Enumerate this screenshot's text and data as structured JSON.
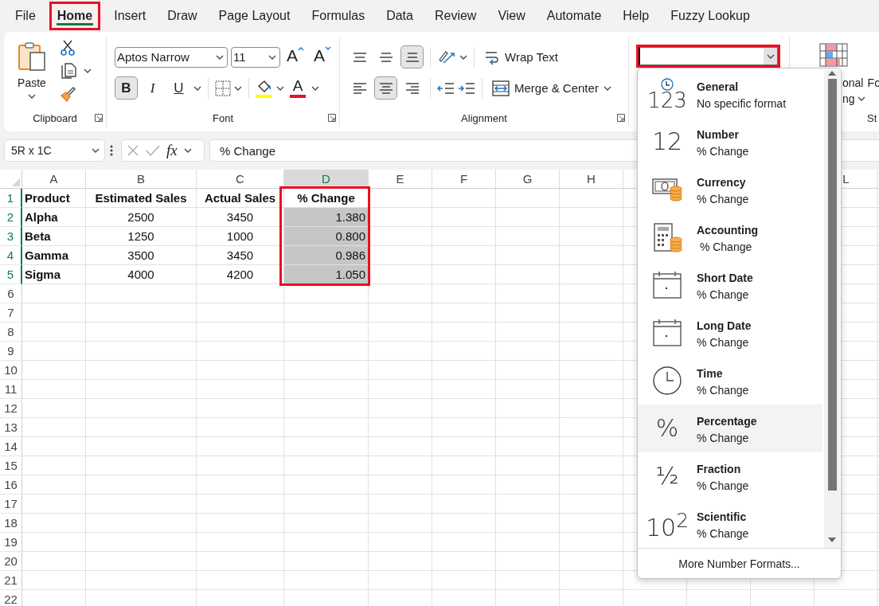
{
  "menu_tabs": [
    {
      "label": "File",
      "selected": false,
      "highlighted": false
    },
    {
      "label": "Home",
      "selected": true,
      "highlighted": true
    },
    {
      "label": "Insert",
      "selected": false,
      "highlighted": false
    },
    {
      "label": "Draw",
      "selected": false,
      "highlighted": false
    },
    {
      "label": "Page Layout",
      "selected": false,
      "highlighted": false
    },
    {
      "label": "Formulas",
      "selected": false,
      "highlighted": false
    },
    {
      "label": "Data",
      "selected": false,
      "highlighted": false
    },
    {
      "label": "Review",
      "selected": false,
      "highlighted": false
    },
    {
      "label": "View",
      "selected": false,
      "highlighted": false
    },
    {
      "label": "Automate",
      "selected": false,
      "highlighted": false
    },
    {
      "label": "Help",
      "selected": false,
      "highlighted": false
    },
    {
      "label": "Fuzzy Lookup",
      "selected": false,
      "highlighted": false
    }
  ],
  "ribbon": {
    "clipboard": {
      "paste_label": "Paste",
      "group_label": "Clipboard"
    },
    "font": {
      "font_name": "Aptos Narrow",
      "font_size": "11",
      "grow_glyph": "A",
      "shrink_glyph": "A",
      "font_color_glyph": "A",
      "group_label": "Font",
      "buttons": [
        {
          "kind": "bold",
          "label": "B",
          "selected": true
        },
        {
          "kind": "italic",
          "label": "I",
          "selected": false
        },
        {
          "kind": "underline",
          "label": "U",
          "selected": false
        }
      ]
    },
    "alignment": {
      "group_label": "Alignment",
      "wrap_text": "Wrap Text",
      "merge": "Merge & Center",
      "vertical": [
        {
          "kind": "top",
          "selected": false
        },
        {
          "kind": "middle",
          "selected": false
        },
        {
          "kind": "bottom",
          "selected": true
        }
      ],
      "horizontal": [
        {
          "kind": "left",
          "selected": false
        },
        {
          "kind": "center",
          "selected": true
        },
        {
          "kind": "right",
          "selected": false
        }
      ]
    },
    "number": {
      "highlighted": true
    },
    "styles": {
      "text_1": "onal",
      "text_2": "ng",
      "text_3": "Fo",
      "group_label": "St"
    }
  },
  "formula_bar": {
    "name_box": "5R x 1C",
    "function_label": "fx",
    "formula": "% Change"
  },
  "grid": {
    "columns": [
      {
        "label": "A",
        "selected": false
      },
      {
        "label": "B",
        "selected": false
      },
      {
        "label": "C",
        "selected": false
      },
      {
        "label": "D",
        "selected": true
      },
      {
        "label": "E",
        "selected": false
      },
      {
        "label": "F",
        "selected": false
      },
      {
        "label": "G",
        "selected": false
      },
      {
        "label": "H",
        "selected": false
      },
      {},
      {},
      {},
      {
        "label": "L",
        "selected": false
      }
    ],
    "row_headers": [
      {
        "label": "1",
        "selected": true
      },
      {
        "label": "2",
        "selected": true
      },
      {
        "label": "3",
        "selected": true
      },
      {
        "label": "4",
        "selected": true
      },
      {
        "label": "5",
        "selected": true
      },
      {
        "label": "6",
        "selected": false
      },
      {
        "label": "7",
        "selected": false
      },
      {
        "label": "8",
        "selected": false
      },
      {
        "label": "9",
        "selected": false
      },
      {
        "label": "10",
        "selected": false
      },
      {
        "label": "11",
        "selected": false
      },
      {
        "label": "12",
        "selected": false
      },
      {
        "label": "13",
        "selected": false
      },
      {
        "label": "14",
        "selected": false
      },
      {
        "label": "15",
        "selected": false
      },
      {
        "label": "16",
        "selected": false
      },
      {
        "label": "17",
        "selected": false
      },
      {
        "label": "18",
        "selected": false
      },
      {
        "label": "19",
        "selected": false
      },
      {
        "label": "20",
        "selected": false
      },
      {
        "label": "21",
        "selected": false
      },
      {
        "label": "22",
        "selected": false
      }
    ],
    "rows": [
      {
        "cells": [
          {
            "text": "Product",
            "selected": false,
            "highlighted": false
          },
          {
            "text": "Estimated Sales",
            "selected": false,
            "highlighted": false
          },
          {
            "text": "Actual Sales",
            "selected": false,
            "highlighted": false
          },
          {
            "text": "% Change",
            "selected": false,
            "highlighted": true
          }
        ]
      },
      {
        "cells": [
          {
            "text": "Alpha",
            "selected": false,
            "highlighted": false
          },
          {
            "text": "2500",
            "selected": false,
            "highlighted": false
          },
          {
            "text": "3450",
            "selected": false,
            "highlighted": false
          },
          {
            "text": "1.380",
            "selected": true,
            "highlighted": true
          }
        ]
      },
      {
        "cells": [
          {
            "text": "Beta",
            "selected": false,
            "highlighted": false
          },
          {
            "text": "1250",
            "selected": false,
            "highlighted": false
          },
          {
            "text": "1000",
            "selected": false,
            "highlighted": false
          },
          {
            "text": "0.800",
            "selected": true,
            "highlighted": true
          }
        ]
      },
      {
        "cells": [
          {
            "text": "Gamma",
            "selected": false,
            "highlighted": false
          },
          {
            "text": "3500",
            "selected": false,
            "highlighted": false
          },
          {
            "text": "3450",
            "selected": false,
            "highlighted": false
          },
          {
            "text": "0.986",
            "selected": true,
            "highlighted": true
          }
        ]
      },
      {
        "cells": [
          {
            "text": "Sigma",
            "selected": false,
            "highlighted": false
          },
          {
            "text": "4000",
            "selected": false,
            "highlighted": false
          },
          {
            "text": "4200",
            "selected": false,
            "highlighted": false
          },
          {
            "text": "1.050",
            "selected": true,
            "highlighted": true
          }
        ]
      }
    ]
  },
  "number_format_menu": {
    "footer": "More Number Formats...",
    "items": [
      {
        "kind": "general",
        "glyph": "123",
        "name": "General",
        "sample": "No specific format",
        "selected": false
      },
      {
        "kind": "number",
        "glyph": "12",
        "name": "Number",
        "sample": "% Change",
        "selected": false
      },
      {
        "kind": "currency",
        "name": "Currency",
        "sample": "% Change",
        "selected": false
      },
      {
        "kind": "accounting",
        "name": "Accounting",
        "sample": " % Change",
        "selected": false
      },
      {
        "kind": "short_date",
        "name": "Short Date",
        "sample": "% Change",
        "selected": false
      },
      {
        "kind": "long_date",
        "name": "Long Date",
        "sample": "% Change",
        "selected": false
      },
      {
        "kind": "time",
        "name": "Time",
        "sample": "% Change",
        "selected": false
      },
      {
        "kind": "percentage",
        "glyph": "%",
        "name": "Percentage",
        "sample": "% Change",
        "selected": true
      },
      {
        "kind": "fraction",
        "glyph": "½",
        "name": "Fraction",
        "sample": "% Change",
        "selected": false
      },
      {
        "kind": "scientific",
        "glyph": "10$^{2}$",
        "name": "Scientific",
        "sample": "% Change",
        "selected": false
      }
    ]
  }
}
